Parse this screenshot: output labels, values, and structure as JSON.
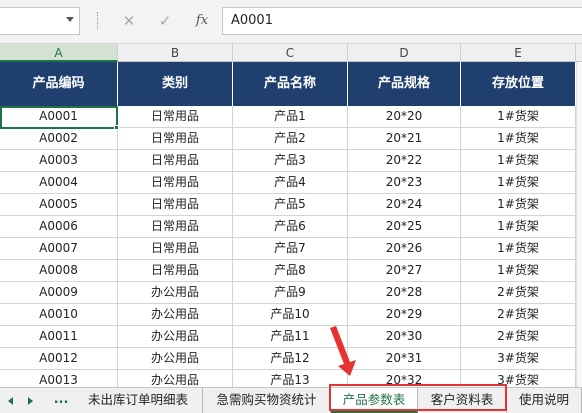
{
  "formula_bar": {
    "name_box": "",
    "cancel_icon": "✕",
    "enter_icon": "✓",
    "fx_label": "fx",
    "formula_value": "A0001"
  },
  "columns": [
    "A",
    "B",
    "C",
    "D",
    "E"
  ],
  "table": {
    "headers": [
      "产品编码",
      "类别",
      "产品名称",
      "产品规格",
      "存放位置"
    ],
    "rows": [
      [
        "A0001",
        "日常用品",
        "产品1",
        "20*20",
        "1#货架"
      ],
      [
        "A0002",
        "日常用品",
        "产品2",
        "20*21",
        "1#货架"
      ],
      [
        "A0003",
        "日常用品",
        "产品3",
        "20*22",
        "1#货架"
      ],
      [
        "A0004",
        "日常用品",
        "产品4",
        "20*23",
        "1#货架"
      ],
      [
        "A0005",
        "日常用品",
        "产品5",
        "20*24",
        "1#货架"
      ],
      [
        "A0006",
        "日常用品",
        "产品6",
        "20*25",
        "1#货架"
      ],
      [
        "A0007",
        "日常用品",
        "产品7",
        "20*26",
        "1#货架"
      ],
      [
        "A0008",
        "日常用品",
        "产品8",
        "20*27",
        "1#货架"
      ],
      [
        "A0009",
        "办公用品",
        "产品9",
        "20*28",
        "2#货架"
      ],
      [
        "A0010",
        "办公用品",
        "产品10",
        "20*29",
        "2#货架"
      ],
      [
        "A0011",
        "办公用品",
        "产品11",
        "20*30",
        "2#货架"
      ],
      [
        "A0012",
        "办公用品",
        "产品12",
        "20*31",
        "3#货架"
      ],
      [
        "A0013",
        "办公用品",
        "产品13",
        "20*32",
        "3#货架"
      ]
    ]
  },
  "sheet_tabs": {
    "ellipsis": "...",
    "tabs": [
      "未出库订单明细表",
      "急需购买物资统计",
      "产品参数表",
      "客户资料表",
      "使用说明"
    ],
    "active_index": 2
  },
  "colors": {
    "header_bg": "#1f3f6e",
    "accent_green": "#217346",
    "annotation_red": "#e63232"
  }
}
